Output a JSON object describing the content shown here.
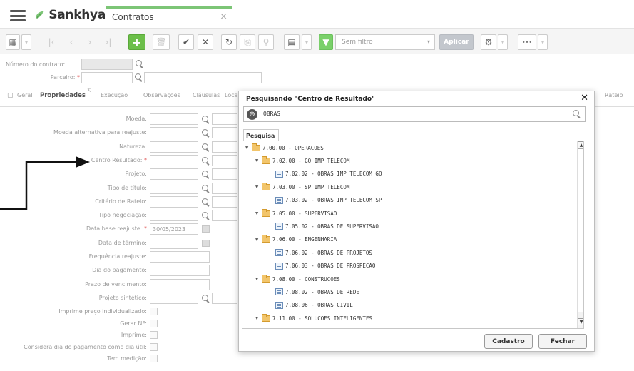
{
  "app": {
    "logo_text": "Sankhya",
    "tab_title": "Contratos",
    "tab_close": "×"
  },
  "toolbar": {
    "filter_label": "Sem filtro",
    "apply_label": "Aplicar",
    "more_label": "•••",
    "caret": "▾"
  },
  "header": {
    "contract_number_label": "Número do contrato:",
    "partner_label": "Parceiro:",
    "required_mark": "*"
  },
  "tabs": [
    "Geral",
    "Propriedades",
    "Execução",
    "Observações",
    "Cláusulas",
    "Loca",
    "Rateio"
  ],
  "form": {
    "fields": [
      {
        "label": "Moeda:",
        "value": "",
        "required": false
      },
      {
        "label": "Moeda alternativa para reajuste:",
        "value": "",
        "required": false
      },
      {
        "label": "Natureza:",
        "value": "",
        "required": false
      },
      {
        "label": "Centro Resultado:",
        "value": "",
        "required": true
      },
      {
        "label": "Projeto:",
        "value": "",
        "required": false
      },
      {
        "label": "Tipo de título:",
        "value": "",
        "required": false
      },
      {
        "label": "Critério de Rateio:",
        "value": "",
        "required": false
      },
      {
        "label": "Tipo negociação:",
        "value": "",
        "required": false
      },
      {
        "label": "Data base reajuste:",
        "value": "30/05/2023",
        "required": true
      },
      {
        "label": "Data de término:",
        "value": "",
        "required": false
      },
      {
        "label": "Frequência reajuste:",
        "value": "",
        "required": false
      },
      {
        "label": "Dia do pagamento:",
        "value": "",
        "required": false
      },
      {
        "label": "Prazo de vencimento:",
        "value": "",
        "required": false
      },
      {
        "label": "Projeto sintético:",
        "value": "",
        "required": false
      }
    ],
    "checkboxes": [
      "Imprime preço individualizado:",
      "Gerar NF:",
      "Imprime:",
      "Considera dia do pagamento como dia útil:",
      "Tem medição:"
    ]
  },
  "dialog": {
    "title": "Pesquisando \"Centro de Resultado\"",
    "close": "✕",
    "search_value": "OBRAS",
    "tab_label": "Pesquisa",
    "tree": [
      {
        "label": "7.00.00 - OPERACOES",
        "level": 0,
        "type": "folder"
      },
      {
        "label": "7.02.00 - GO IMP TELECOM",
        "level": 1,
        "type": "folder"
      },
      {
        "label": "7.02.02 - OBRAS IMP TELECOM GO",
        "level": 2,
        "type": "leaf"
      },
      {
        "label": "7.03.00 - SP IMP TELECOM",
        "level": 1,
        "type": "folder"
      },
      {
        "label": "7.03.02 - OBRAS IMP TELECOM SP",
        "level": 2,
        "type": "leaf"
      },
      {
        "label": "7.05.00 - SUPERVISAO",
        "level": 1,
        "type": "folder"
      },
      {
        "label": "7.05.02 - OBRAS DE SUPERVISAO",
        "level": 2,
        "type": "leaf"
      },
      {
        "label": "7.06.00 - ENGENHARIA",
        "level": 1,
        "type": "folder"
      },
      {
        "label": "7.06.02 - OBRAS DE PROJETOS",
        "level": 2,
        "type": "leaf"
      },
      {
        "label": "7.06.03 - OBRAS DE PROSPECAO",
        "level": 2,
        "type": "leaf"
      },
      {
        "label": "7.08.00 - CONSTRUCOES",
        "level": 1,
        "type": "folder"
      },
      {
        "label": "7.08.02 - OBRAS DE REDE",
        "level": 2,
        "type": "leaf"
      },
      {
        "label": "7.08.06 - OBRAS CIVIL",
        "level": 2,
        "type": "leaf"
      },
      {
        "label": "7.11.00 - SOLUCOES INTELIGENTES",
        "level": 1,
        "type": "folder"
      }
    ],
    "expand_marker": "▼",
    "btn_register": "Cadastro",
    "btn_close": "Fechar"
  },
  "colors": {
    "accent_green": "#7cc576",
    "required_red": "#e05050"
  }
}
